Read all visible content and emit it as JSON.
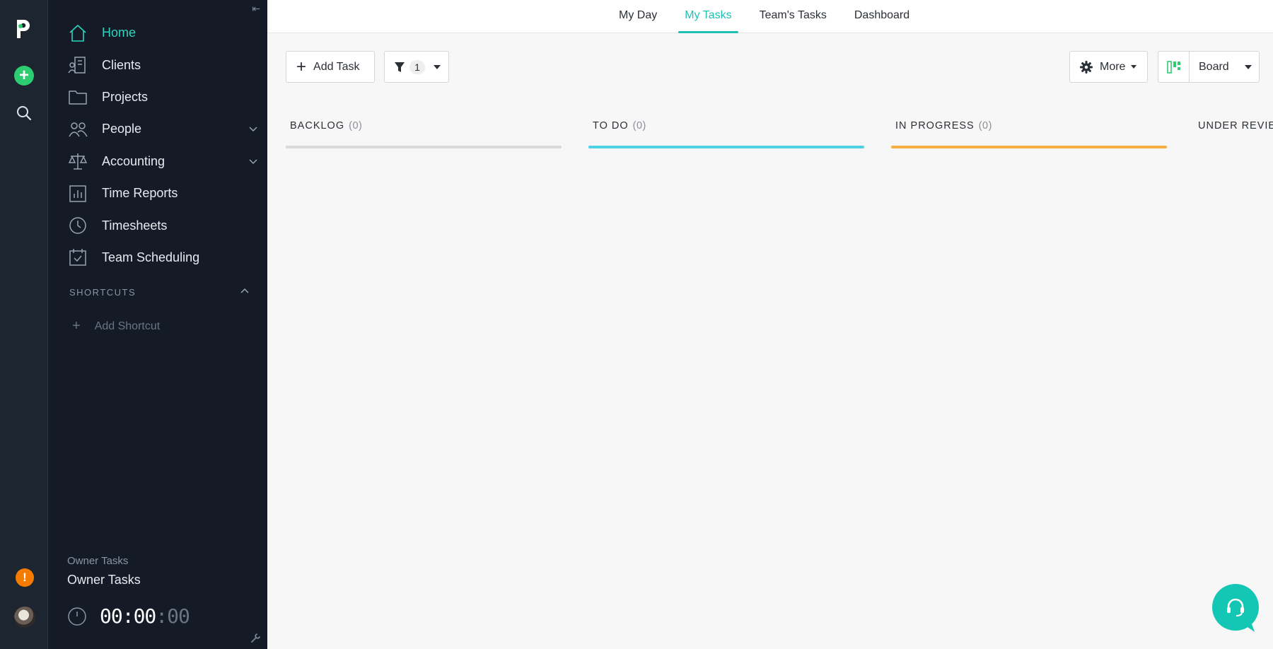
{
  "sidebar": {
    "items": [
      {
        "label": "Home",
        "icon": "home-icon"
      },
      {
        "label": "Clients",
        "icon": "clients-icon"
      },
      {
        "label": "Projects",
        "icon": "folder-icon"
      },
      {
        "label": "People",
        "icon": "people-icon"
      },
      {
        "label": "Accounting",
        "icon": "scale-icon"
      },
      {
        "label": "Time Reports",
        "icon": "chart-icon"
      },
      {
        "label": "Timesheets",
        "icon": "clock-icon"
      },
      {
        "label": "Team Scheduling",
        "icon": "calendar-check-icon"
      }
    ],
    "shortcuts_heading": "SHORTCUTS",
    "add_shortcut": "Add Shortcut",
    "owner_small": "Owner Tasks",
    "owner_big": "Owner Tasks",
    "timer_main": "00:00",
    "timer_sec": ":00"
  },
  "topnav": {
    "tabs": [
      "My Day",
      "My Tasks",
      "Team's Tasks",
      "Dashboard"
    ],
    "active_tab": "My Tasks"
  },
  "toolbar": {
    "add_task": "Add Task",
    "filter_count": "1",
    "more": "More",
    "view": "Board"
  },
  "board": {
    "columns": [
      {
        "title": "BACKLOG",
        "count": "(0)",
        "color": "#dadada"
      },
      {
        "title": "TO DO",
        "count": "(0)",
        "color": "#4fd1e3"
      },
      {
        "title": "IN PROGRESS",
        "count": "(0)",
        "color": "#f6ad45"
      },
      {
        "title": "UNDER REVIEW",
        "count": "",
        "color": "#e5484d"
      }
    ]
  },
  "colors": {
    "accent": "#1fbfb3",
    "sidebar_bg": "#141b27",
    "rail_bg": "#1d2530"
  }
}
